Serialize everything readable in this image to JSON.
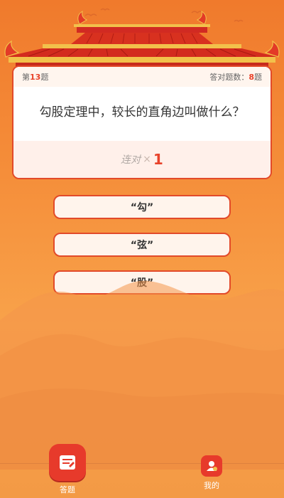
{
  "quiz": {
    "question_number_prefix": "第",
    "question_number": "13",
    "question_number_suffix": "题",
    "correct_count_label": "答对题数：",
    "correct_count": "8",
    "correct_count_suffix": "题",
    "question_text": "勾股定理中，较长的直角边叫做什么？",
    "streak_label": "连对",
    "streak_times": "×",
    "streak_count": "1"
  },
  "options": [
    {
      "label": "“勾”"
    },
    {
      "label": "“弦”"
    },
    {
      "label": "“股”"
    }
  ],
  "nav": {
    "answer_label": "答题",
    "mine_label": "我的"
  },
  "colors": {
    "accent": "#e73a2b",
    "background_top": "#f07a2c",
    "background_bottom": "#f39a45"
  },
  "icons": {
    "answer": "answer-sheet-icon",
    "mine": "user-icon"
  }
}
